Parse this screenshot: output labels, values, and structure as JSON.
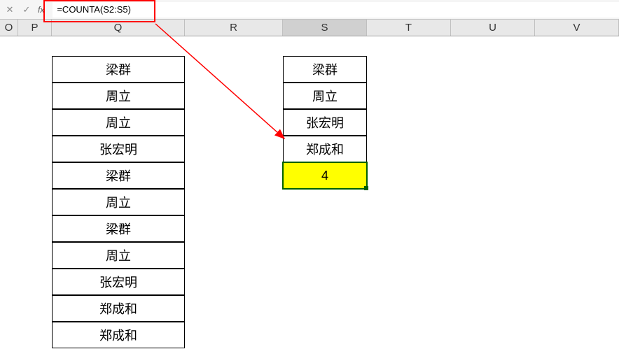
{
  "formula_bar": {
    "fx_label": "fx",
    "formula": "=COUNTA(S2:S5)"
  },
  "columns": {
    "o": "O",
    "p": "P",
    "q": "Q",
    "r": "R",
    "s": "S",
    "t": "T",
    "u": "U",
    "v": "V"
  },
  "q_column": {
    "r0": "梁群",
    "r1": "周立",
    "r2": "周立",
    "r3": "张宏明",
    "r4": "梁群",
    "r5": "周立",
    "r6": "梁群",
    "r7": "周立",
    "r8": "张宏明",
    "r9": "郑成和",
    "r10": "郑成和"
  },
  "s_column": {
    "r0": "梁群",
    "r1": "周立",
    "r2": "张宏明",
    "r3": "郑成和",
    "r4": "4"
  },
  "chart_data": {
    "type": "table",
    "active_cell": "S6",
    "formula": "=COUNTA(S2:S5)",
    "result": 4,
    "columns": {
      "Q": [
        "梁群",
        "周立",
        "周立",
        "张宏明",
        "梁群",
        "周立",
        "梁群",
        "周立",
        "张宏明",
        "郑成和",
        "郑成和"
      ],
      "S": [
        "梁群",
        "周立",
        "张宏明",
        "郑成和",
        4
      ]
    }
  }
}
